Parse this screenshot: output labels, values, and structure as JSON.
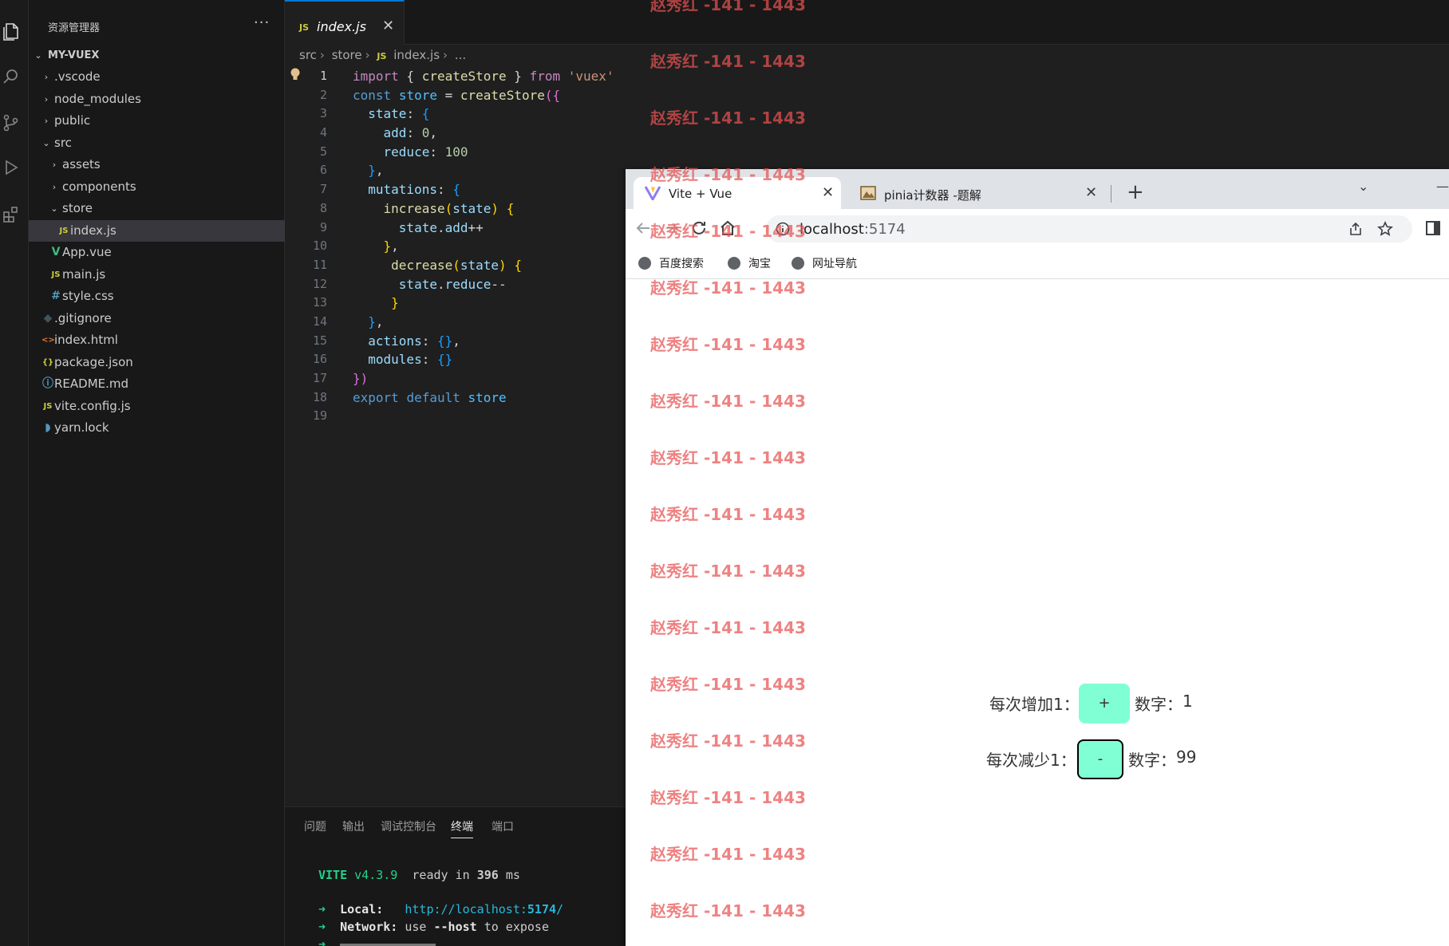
{
  "explorer": {
    "title": "资源管理器",
    "more": "···",
    "root": "MY-VUEX",
    "items": [
      {
        "label": ".vscode",
        "type": "folder",
        "expanded": false,
        "depth": 1,
        "icon": "folder"
      },
      {
        "label": "node_modules",
        "type": "folder",
        "expanded": false,
        "depth": 1,
        "icon": "folder"
      },
      {
        "label": "public",
        "type": "folder",
        "expanded": false,
        "depth": 1,
        "icon": "folder"
      },
      {
        "label": "src",
        "type": "folder",
        "expanded": true,
        "depth": 1,
        "icon": "folder"
      },
      {
        "label": "assets",
        "type": "folder",
        "expanded": false,
        "depth": 2,
        "icon": "folder"
      },
      {
        "label": "components",
        "type": "folder",
        "expanded": false,
        "depth": 2,
        "icon": "folder"
      },
      {
        "label": "store",
        "type": "folder",
        "expanded": true,
        "depth": 2,
        "icon": "folder"
      },
      {
        "label": "index.js",
        "type": "file",
        "depth": 3,
        "icon": "js",
        "selected": true
      },
      {
        "label": "App.vue",
        "type": "file",
        "depth": 2,
        "icon": "vue"
      },
      {
        "label": "main.js",
        "type": "file",
        "depth": 2,
        "icon": "js"
      },
      {
        "label": "style.css",
        "type": "file",
        "depth": 2,
        "icon": "css"
      },
      {
        "label": ".gitignore",
        "type": "file",
        "depth": 1,
        "icon": "git"
      },
      {
        "label": "index.html",
        "type": "file",
        "depth": 1,
        "icon": "html"
      },
      {
        "label": "package.json",
        "type": "file",
        "depth": 1,
        "icon": "json"
      },
      {
        "label": "README.md",
        "type": "file",
        "depth": 1,
        "icon": "info"
      },
      {
        "label": "vite.config.js",
        "type": "file",
        "depth": 1,
        "icon": "js"
      },
      {
        "label": "yarn.lock",
        "type": "file",
        "depth": 1,
        "icon": "yarn"
      }
    ]
  },
  "editor": {
    "tab": {
      "label": "index.js",
      "badge": "JS",
      "close": "✕"
    },
    "breadcrumb": [
      "src",
      "store",
      "index.js",
      "..."
    ],
    "code_lines": [
      [
        [
          "kw",
          "import"
        ],
        [
          "p",
          " { "
        ],
        [
          "fn",
          "createStore"
        ],
        [
          "p",
          " } "
        ],
        [
          "kw",
          "from"
        ],
        [
          "p",
          " "
        ],
        [
          "str",
          "'vuex'"
        ]
      ],
      [
        [
          "kw",
          "const"
        ],
        [
          "p",
          " "
        ],
        [
          "var",
          "store"
        ],
        [
          "p",
          " = "
        ],
        [
          "fn",
          "createStore"
        ],
        [
          "b1",
          "({"
        ]
      ],
      [
        [
          "p",
          "  "
        ],
        [
          "prop",
          "state"
        ],
        [
          "p",
          ": "
        ],
        [
          "b2",
          "{"
        ]
      ],
      [
        [
          "p",
          "    "
        ],
        [
          "prop",
          "add"
        ],
        [
          "p",
          ": "
        ],
        [
          "num",
          "0"
        ],
        [
          "p",
          ","
        ]
      ],
      [
        [
          "p",
          "    "
        ],
        [
          "prop",
          "reduce"
        ],
        [
          "p",
          ": "
        ],
        [
          "num",
          "100"
        ]
      ],
      [
        [
          "p",
          "  "
        ],
        [
          "b2",
          "}"
        ],
        [
          "p",
          ","
        ]
      ],
      [
        [
          "p",
          "  "
        ],
        [
          "prop",
          "mutations"
        ],
        [
          "p",
          ": "
        ],
        [
          "b2",
          "{"
        ]
      ],
      [
        [
          "p",
          "    "
        ],
        [
          "fn",
          "increase"
        ],
        [
          "b3",
          "("
        ],
        [
          "prop",
          "state"
        ],
        [
          "b3",
          ")"
        ],
        [
          "p",
          " "
        ],
        [
          "b3",
          "{"
        ]
      ],
      [
        [
          "p",
          "      "
        ],
        [
          "prop",
          "state"
        ],
        [
          "p",
          "."
        ],
        [
          "prop",
          "add"
        ],
        [
          "p",
          "++"
        ]
      ],
      [
        [
          "p",
          "    "
        ],
        [
          "b3",
          "}"
        ],
        [
          "p",
          ","
        ]
      ],
      [
        [
          "p",
          "     "
        ],
        [
          "fn",
          "decrease"
        ],
        [
          "b3",
          "("
        ],
        [
          "prop",
          "state"
        ],
        [
          "b3",
          ")"
        ],
        [
          "p",
          " "
        ],
        [
          "b3",
          "{"
        ]
      ],
      [
        [
          "p",
          "      "
        ],
        [
          "prop",
          "state"
        ],
        [
          "p",
          "."
        ],
        [
          "prop",
          "reduce"
        ],
        [
          "p",
          "--"
        ]
      ],
      [
        [
          "p",
          "     "
        ],
        [
          "b3",
          "}"
        ]
      ],
      [
        [
          "p",
          "  "
        ],
        [
          "b2",
          "}"
        ],
        [
          "p",
          ","
        ]
      ],
      [
        [
          "p",
          "  "
        ],
        [
          "prop",
          "actions"
        ],
        [
          "p",
          ": "
        ],
        [
          "b2",
          "{}"
        ],
        [
          "p",
          ","
        ]
      ],
      [
        [
          "p",
          "  "
        ],
        [
          "prop",
          "modules"
        ],
        [
          "p",
          ": "
        ],
        [
          "b2",
          "{}"
        ]
      ],
      [
        [
          "b1",
          "})"
        ]
      ],
      [
        [
          "kw",
          "export"
        ],
        [
          "p",
          " "
        ],
        [
          "kw",
          "default"
        ],
        [
          "p",
          " "
        ],
        [
          "var",
          "store"
        ]
      ],
      []
    ],
    "current_line": 1
  },
  "panel": {
    "tabs": [
      "问题",
      "输出",
      "调试控制台",
      "终端",
      "端口"
    ],
    "active_tab": "终端",
    "terminal": {
      "vite_label": "VITE",
      "vite_version": "v4.3.9",
      "ready_text": "ready in",
      "ready_ms": "396",
      "ready_unit": "ms",
      "local_label": "Local:",
      "local_url_prefix": "http://localhost:",
      "local_url_port": "5174",
      "local_url_suffix": "/",
      "network_label": "Network:",
      "network_text_1": "use",
      "network_flag": "--host",
      "network_text_2": "to expose"
    }
  },
  "browser": {
    "tabs": [
      {
        "title": "Vite + Vue",
        "icon": "vite-icon",
        "close": "✕",
        "active": true
      },
      {
        "title": "pinia计数器 -题解",
        "icon": "image-favicon",
        "close": "✕",
        "active": false
      }
    ],
    "new_tab": "+",
    "url_host": "localhost",
    "url_port": ":5174",
    "bookmarks": [
      "百度搜索",
      "淘宝",
      "网址导航"
    ],
    "page": {
      "increase_label": "每次增加1：",
      "increase_button": "+",
      "increase_count_label": "数字：",
      "increase_count": "1",
      "decrease_label": "每次减少1：",
      "decrease_button": "-",
      "decrease_count_label": "数字：",
      "decrease_count": "99"
    }
  },
  "watermark": {
    "text": "赵秀红 -141 - 1443",
    "count": 17
  },
  "colors": {
    "kw": "#c586c0",
    "kw_blue": "#569cd6",
    "fn": "#dcdcaa",
    "str": "#ce9178",
    "num": "#b5cea8",
    "prop": "#9cdcfe",
    "var": "#4fc1ff",
    "b1": "#da70d6",
    "b2": "#179fff",
    "b3": "#ffd700",
    "button_bg": "#80ffd4",
    "watermark": "#e85252"
  }
}
